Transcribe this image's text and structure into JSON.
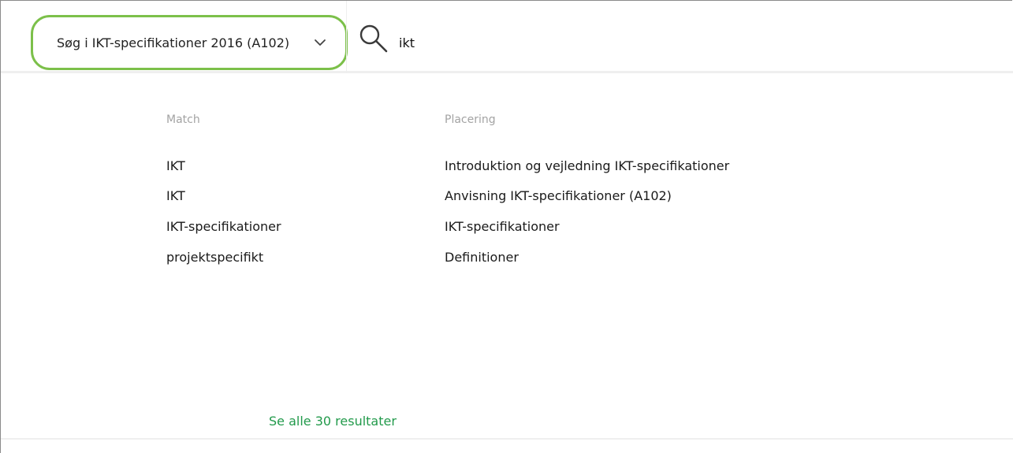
{
  "search": {
    "scope_label": "Søg i IKT-specifikationer 2016 (A102)",
    "query": "ikt",
    "icon": "search-icon",
    "chevron_icon": "chevron-down-icon"
  },
  "results": {
    "headers": {
      "match": "Match",
      "location": "Placering"
    },
    "rows": [
      {
        "match": "IKT",
        "location": "Introduktion og vejledning IKT-specifikationer"
      },
      {
        "match": "IKT",
        "location": "Anvisning IKT-specifikationer (A102)"
      },
      {
        "match": "IKT-specifikationer",
        "location": "IKT-specifikationer"
      },
      {
        "match": "projektspecifikt",
        "location": "Definitioner"
      }
    ],
    "see_all_label": "Se alle 30 resultater"
  },
  "colors": {
    "accent_green": "#7cc04a",
    "link_green": "#229a4b",
    "header_gray": "#a3a3a3"
  }
}
